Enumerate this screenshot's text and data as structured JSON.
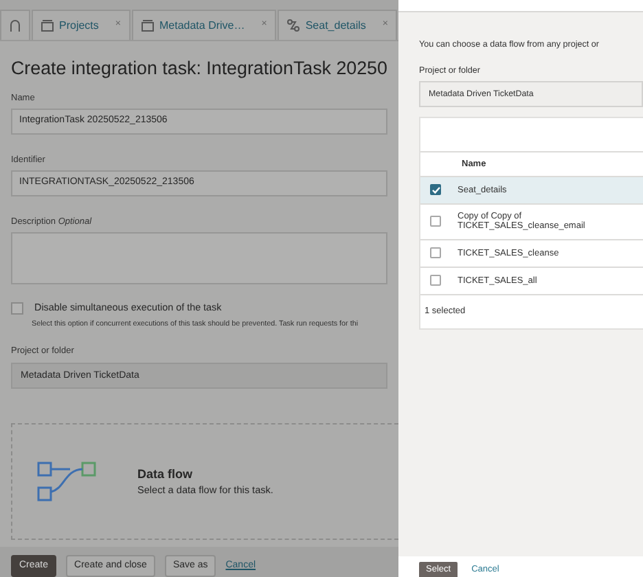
{
  "tabs": [
    {
      "kind": "home"
    },
    {
      "kind": "project",
      "label": "Projects",
      "close": "×"
    },
    {
      "kind": "project",
      "label": "Metadata Drive…",
      "close": "×"
    },
    {
      "kind": "dataflow",
      "label": "Seat_details",
      "close": "×"
    }
  ],
  "form": {
    "title": "Create integration task: IntegrationTask 20250",
    "fields": [
      {
        "kind": "input",
        "label": "Name",
        "value": "IntegrationTask 20250522_213506"
      },
      {
        "kind": "input",
        "label": "Identifier",
        "value": "INTEGRATIONTASK_20250522_213506"
      },
      {
        "kind": "textarea",
        "label": "Description",
        "hint": "Optional"
      }
    ],
    "option": {
      "label": "Disable simultaneous execution of the task",
      "help": "Select this option if concurrent executions of this task should be prevented. Task run requests for thi",
      "checked": false
    },
    "project": {
      "label": "Project or folder",
      "value": "Metadata Driven TicketData"
    },
    "data_flow": {
      "title": "Data flow",
      "text": "Select a data flow for this task."
    },
    "buttons": [
      {
        "kind": "primary",
        "label": "Create"
      },
      {
        "kind": "secondary",
        "label": "Create and close"
      },
      {
        "kind": "secondary",
        "label": "Save as"
      },
      {
        "kind": "link",
        "label": "Cancel"
      }
    ]
  },
  "panel": {
    "intro": "You can choose a data flow from any project or",
    "project": {
      "label": "Project or folder",
      "value": "Metadata Driven TicketData"
    },
    "table": {
      "columns": [
        "Name"
      ],
      "rows": [
        {
          "name": "Seat_details",
          "selected": true
        },
        {
          "name": "Copy of Copy of TICKET_SALES_cleanse_email",
          "selected": false
        },
        {
          "name": "TICKET_SALES_cleanse",
          "selected": false
        },
        {
          "name": "TICKET_SALES_all",
          "selected": false
        }
      ],
      "footer": "1 selected"
    },
    "buttons": [
      {
        "kind": "primary",
        "label": "Select"
      },
      {
        "kind": "link",
        "label": "Cancel"
      }
    ]
  }
}
